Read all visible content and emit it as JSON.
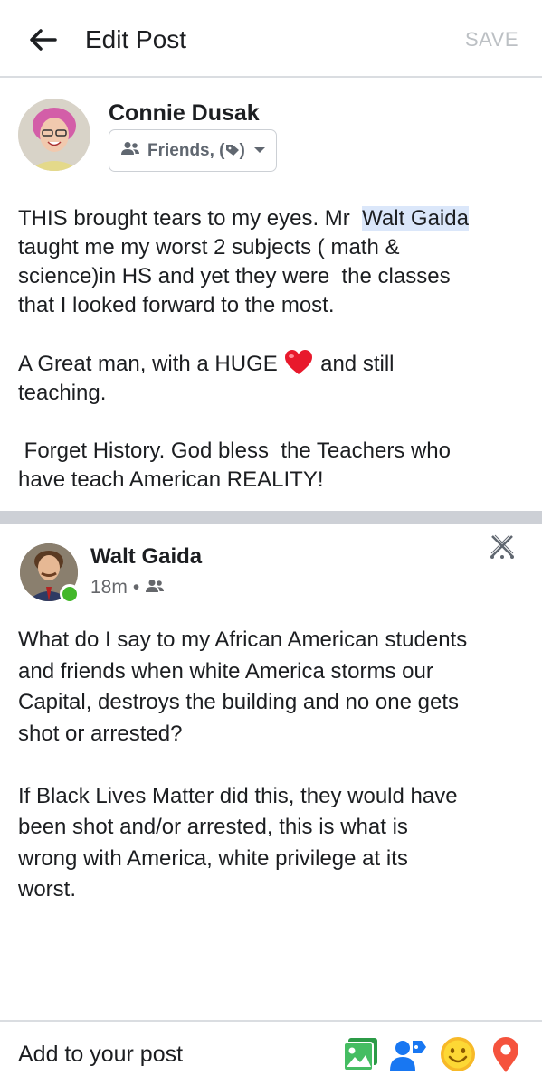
{
  "header": {
    "title": "Edit Post",
    "save_label": "SAVE",
    "back_icon": "arrow-left-icon"
  },
  "author": {
    "name": "Connie Dusak",
    "audience_label": "Friends, (",
    "audience_suffix": ")",
    "audience_icon": "friends-icon",
    "tag_icon": "tag-icon",
    "dropdown_icon": "caret-down-icon"
  },
  "post": {
    "text_before_mention": "THIS brought tears to my eyes. Mr  ",
    "mention": "Walt Gaida",
    "text_after_mention": "\ntaught me my worst 2 subjects ( math &\nscience)in HS and yet they were  the classes\nthat I looked forward to the most.\n\nA Great man, with a HUGE ",
    "heart_icon": "red-heart-icon",
    "text_end": " and still\nteaching.\n\n Forget History. God bless  the Teachers who\nhave teach American REALITY!"
  },
  "shared_post": {
    "author_name": "Walt Gaida",
    "time": "18m",
    "separator": "•",
    "privacy_icon": "friends-icon",
    "online": true,
    "remove_icon": "close-x-icon",
    "text": "What do I say to my African American students\nand friends when white America storms our\nCapital, destroys the building and no one gets\nshot or arrested?\n\nIf Black Lives Matter did this, they would have\nbeen shot and/or arrested, this is what is\nwrong with America, white privilege at its\nworst."
  },
  "bottom_bar": {
    "label": "Add to your post",
    "tools": [
      {
        "name": "photo-icon",
        "color": "#45bd62"
      },
      {
        "name": "tag-people-icon",
        "color": "#1877f2"
      },
      {
        "name": "feeling-icon",
        "color": "#f7b928"
      },
      {
        "name": "location-pin-icon",
        "color": "#f5533d"
      }
    ]
  },
  "colors": {
    "mention_highlight": "#dbe7fa",
    "divider": "#cdd0d6",
    "online": "#42b72a",
    "save_disabled": "#bcc0c4"
  }
}
